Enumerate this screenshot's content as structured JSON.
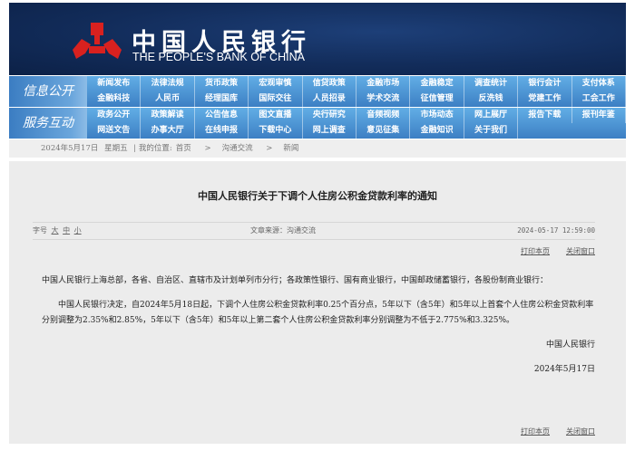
{
  "header": {
    "title_cn": "中国人民银行",
    "title_en": "THE PEOPLE'S BANK OF CHINA"
  },
  "nav": [
    {
      "label": "信息公开",
      "items": [
        "新闻发布",
        "法律法规",
        "货币政策",
        "宏观审慎",
        "信贷政策",
        "金融市场",
        "金融稳定",
        "调查统计",
        "银行会计",
        "支付体系",
        "金融科技",
        "人民币",
        "经理国库",
        "国际交往",
        "人员招录",
        "学术交流",
        "征信管理",
        "反洗钱",
        "党建工作",
        "工会工作"
      ]
    },
    {
      "label": "服务互动",
      "items": [
        "政务公开",
        "政策解读",
        "公告信息",
        "图文直播",
        "央行研究",
        "音频视频",
        "市场动态",
        "网上展厅",
        "报告下载",
        "报刊年鉴",
        "网送文告",
        "办事大厅",
        "在线申报",
        "下载中心",
        "网上调查",
        "意见征集",
        "金融知识",
        "关于我们"
      ]
    }
  ],
  "breadcrumb": {
    "date": "2024年5月17日",
    "weekday": "星期五",
    "location_label": "我的位置:",
    "items": [
      "首页",
      "沟通交流",
      "新闻"
    ],
    "sep": ">"
  },
  "article": {
    "title": "中国人民银行关于下调个人住房公积金贷款利率的通知",
    "font_label": "字号",
    "font_sizes": [
      "大",
      "中",
      "小"
    ],
    "source": "文章来源：沟通交流",
    "time": "2024-05-17 12:59:00",
    "print": "打印本页",
    "close": "关闭窗口",
    "paragraphs": [
      "中国人民银行上海总部，各省、自治区、直辖市及计划单列市分行；各政策性银行、国有商业银行，中国邮政储蓄银行，各股份制商业银行：",
      "中国人民银行决定，自2024年5月18日起，下调个人住房公积金贷款利率0.25个百分点，5年以下（含5年）和5年以上首套个人住房公积金贷款利率分别调整为2.35%和2.85%，5年以下（含5年）和5年以上第二套个人住房公积金贷款利率分别调整为不低于2.775%和3.325%。"
    ],
    "signature": "中国人民银行",
    "sign_date": "2024年5月17日"
  }
}
